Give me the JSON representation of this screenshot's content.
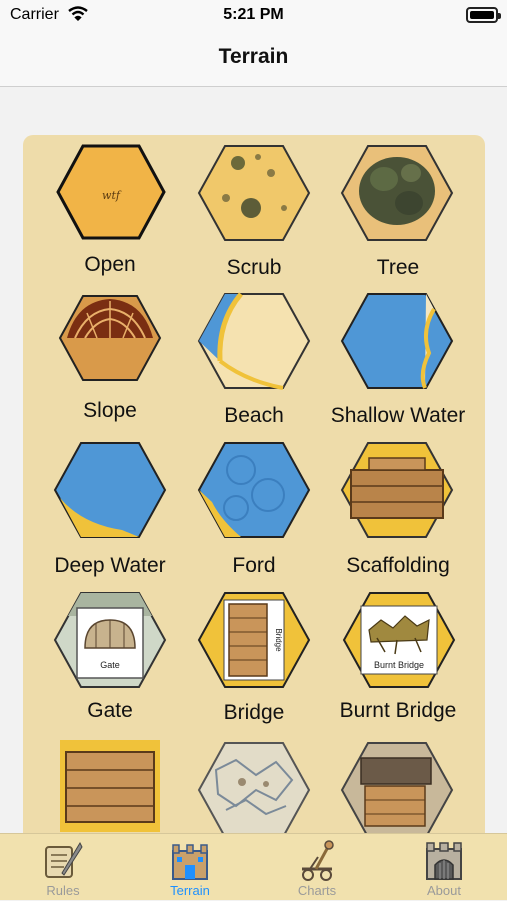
{
  "status_bar": {
    "carrier": "Carrier",
    "time": "5:21 PM"
  },
  "nav": {
    "title": "Terrain"
  },
  "terrain_items": [
    {
      "label": "Open",
      "icon": "open-terrain-hex"
    },
    {
      "label": "Scrub",
      "icon": "scrub-terrain-hex"
    },
    {
      "label": "Tree",
      "icon": "tree-terrain-hex"
    },
    {
      "label": "Slope",
      "icon": "slope-terrain-hex"
    },
    {
      "label": "Beach",
      "icon": "beach-terrain-hex"
    },
    {
      "label": "Shallow Water",
      "icon": "shallow-water-hex"
    },
    {
      "label": "Deep Water",
      "icon": "deep-water-hex"
    },
    {
      "label": "Ford",
      "icon": "ford-hex"
    },
    {
      "label": "Scaffolding",
      "icon": "scaffolding-hex"
    },
    {
      "label": "Gate",
      "icon": "gate-hex"
    },
    {
      "label": "Bridge",
      "icon": "bridge-hex"
    },
    {
      "label": "Burnt Bridge",
      "icon": "burnt-bridge-hex"
    },
    {
      "label": "",
      "icon": "wooden-wall-tile"
    },
    {
      "label": "",
      "icon": "rubble-hex"
    },
    {
      "label": "",
      "icon": "building-hex"
    }
  ],
  "hex_text": {
    "open": "wtf",
    "gate": "Gate",
    "bridge": "Bridge",
    "burnt_bridge": "Burnt Bridge"
  },
  "tabs": [
    {
      "label": "Rules",
      "icon": "scroll-quill-icon",
      "active": false
    },
    {
      "label": "Terrain",
      "icon": "castle-icon",
      "active": true
    },
    {
      "label": "Charts",
      "icon": "catapult-icon",
      "active": false
    },
    {
      "label": "About",
      "icon": "gatehouse-icon",
      "active": false
    }
  ],
  "colors": {
    "panel": "#eedcaa",
    "active_tab": "#1e90ff",
    "inactive_tab": "#9a9a9a",
    "water": "#4f97d6",
    "sand": "#f0c23a"
  }
}
